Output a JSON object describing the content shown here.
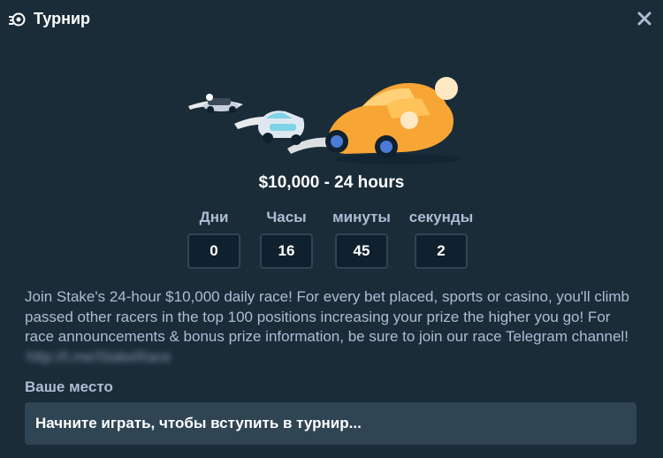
{
  "header": {
    "title": "Турнир"
  },
  "prize": {
    "text": "$10,000 - 24 hours"
  },
  "countdown": {
    "days_label": "Дни",
    "days_value": "0",
    "hours_label": "Часы",
    "hours_value": "16",
    "minutes_label": "минуты",
    "minutes_value": "45",
    "seconds_label": "секунды",
    "seconds_value": "2"
  },
  "description": {
    "text": "Join Stake's 24-hour $10,000 daily race! For every bet placed, sports or casino, you'll climb passed other racers in the top 100 positions increasing your prize the higher you go! For race announcements & bonus prize information, be sure to join our race Telegram channel!",
    "link": "http://t.me/StakeRace"
  },
  "your_place": {
    "label": "Ваше место",
    "status": "Начните играть, чтобы вступить в турнир..."
  },
  "colors": {
    "background": "#1a2c38",
    "box_border": "#2f4553",
    "muted_text": "#b1bad3",
    "accent_car": "#f7a534"
  }
}
